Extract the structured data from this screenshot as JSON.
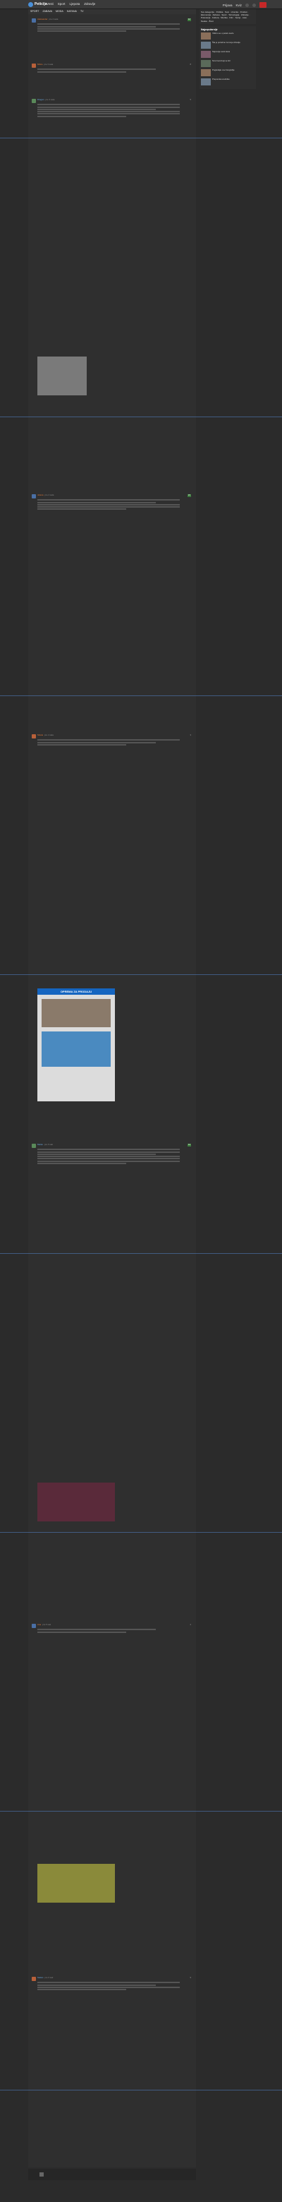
{
  "header": {
    "logo_text": "Peticija",
    "nav": [
      "Vesti",
      "Sport",
      "Ljepota",
      "Zdravlje"
    ],
    "nav_badge": "",
    "right": [
      "Prijava",
      "Kviz"
    ]
  },
  "subnav": [
    "SPORT",
    "ZABAVA",
    "MODA",
    "KAFANA",
    "TV"
  ],
  "sidebar": {
    "tags": "Sve kategorije · Politika · Svet · Hronika · Društvo · Ekonomija · Zabava · Sport · Tehnologija · Zdravlje · Putovanja · Kultura · Muzika · Film · Serije · Auto · Nauka · Život",
    "popular_title": "Najpopularnije",
    "popular": [
      "Vidimo se u petak uveče",
      "Šta je potrebno za tvoje zdravlje",
      "Najnovije vesti dana",
      "Novi trend koji se širi",
      "Pogledajte ove fotografije",
      "Preporuka urednika"
    ]
  },
  "comments": [
    {
      "nick": "Aleksandar",
      "date": "pre 2 sata",
      "votes": "12"
    },
    {
      "nick": "Milica",
      "date": "pre 3 sata",
      "votes": "8"
    },
    {
      "nick": "Dragan",
      "date": "pre 3 sata",
      "votes": "5"
    },
    {
      "nick": "Jelena",
      "date": "pre 4 sata",
      "votes": "21"
    },
    {
      "nick": "Nikola",
      "date": "pre 4 sata",
      "votes": "3"
    },
    {
      "nick": "Marko",
      "date": "pre 5 sati",
      "votes": "14"
    },
    {
      "nick": "Ana",
      "date": "pre 5 sati",
      "votes": "2"
    },
    {
      "nick": "Stefan",
      "date": "pre 6 sati",
      "votes": "9"
    }
  ],
  "embed_caption": "OPREMA ZA PRODAJU"
}
